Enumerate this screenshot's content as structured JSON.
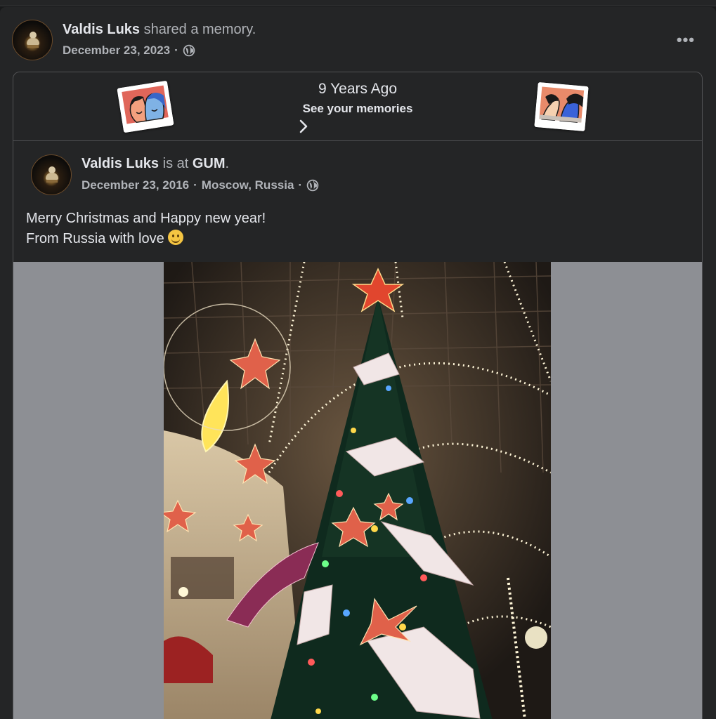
{
  "post": {
    "author": "Valdis Luks",
    "action": "shared a memory.",
    "date": "December 23, 2023",
    "separator": "·",
    "more_icon": "more-horizontal-icon",
    "privacy_icon": "globe-icon"
  },
  "memory": {
    "title": "9 Years Ago",
    "link": "See your memories"
  },
  "original": {
    "author": "Valdis Luks",
    "is_at": "is at",
    "place": "GUM",
    "period": ".",
    "date": "December 23, 2016",
    "location": "Moscow, Russia",
    "separator": "·",
    "text_line1": "Merry Christmas and Happy new year!",
    "text_line2": "From Russia with love",
    "emoji": "slightly-smiling-face"
  },
  "colors": {
    "background": "#18191a",
    "card": "#242526",
    "text_primary": "#e4e6eb",
    "text_secondary": "#b0b3b8",
    "photo_letterbox": "#8d8f94"
  }
}
